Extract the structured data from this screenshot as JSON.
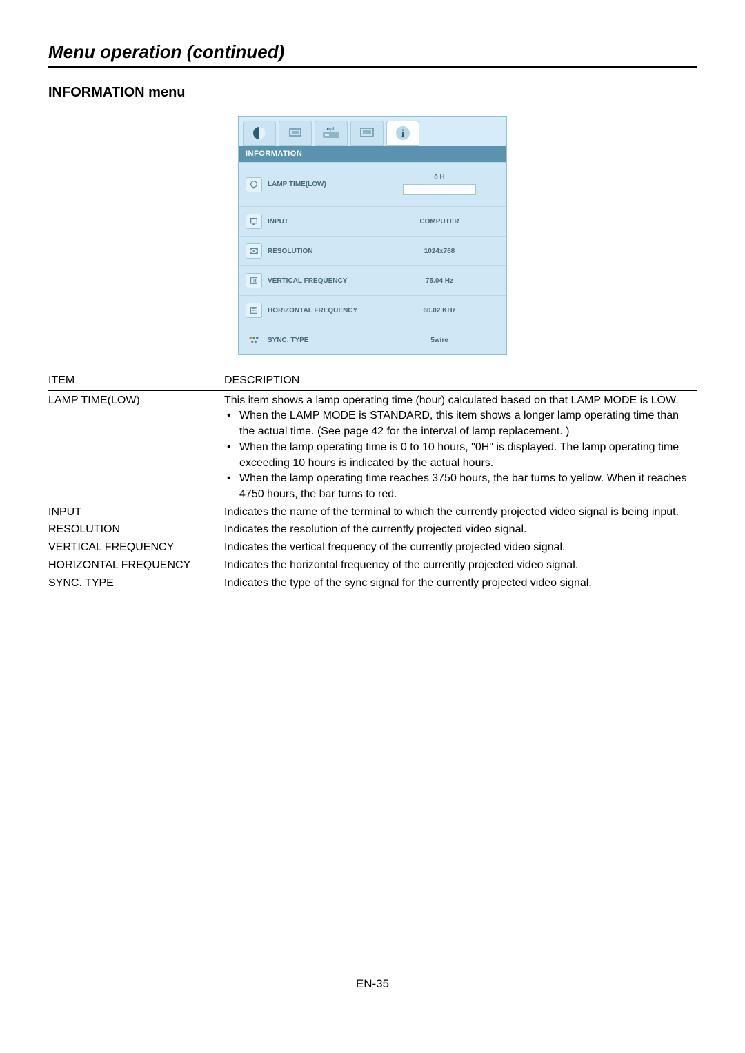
{
  "header": {
    "section_title": "Menu operation (continued)",
    "menu_title": "INFORMATION menu"
  },
  "osd": {
    "tab_opt_label": "opt.",
    "section_label": "INFORMATION",
    "rows": [
      {
        "label": "LAMP TIME(LOW)",
        "value": "0 H"
      },
      {
        "label": "INPUT",
        "value": "COMPUTER"
      },
      {
        "label": "RESOLUTION",
        "value": "1024x768"
      },
      {
        "label": "VERTICAL FREQUENCY",
        "value": "75.04 Hz"
      },
      {
        "label": "HORIZONTAL FREQUENCY",
        "value": "60.02 KHz"
      },
      {
        "label": "SYNC. TYPE",
        "value": "5wire"
      }
    ]
  },
  "table": {
    "head_item": "ITEM",
    "head_desc": "DESCRIPTION",
    "rows": {
      "lamp": {
        "item": "LAMP TIME(LOW)",
        "intro": "This item shows a lamp operating time (hour) calculated based on that LAMP MODE is LOW.",
        "bullets": [
          "When the LAMP MODE is STANDARD, this item shows a longer lamp operating time than the actual time. (See page 42 for the interval of lamp replacement. )",
          "When the lamp operating time is 0 to 10 hours, \"0H\" is displayed. The lamp operating time exceeding 10 hours is indicated by the actual hours.",
          "When the lamp operating time reaches 3750 hours, the bar turns to yellow. When it reaches 4750 hours, the bar turns to red."
        ]
      },
      "input": {
        "item": "INPUT",
        "desc": "Indicates the name of the terminal to which the currently projected video signal is being input."
      },
      "resolution": {
        "item": "RESOLUTION",
        "desc": "Indicates the resolution of the currently projected video signal."
      },
      "vfreq": {
        "item": "VERTICAL FREQUENCY",
        "desc": "Indicates the vertical frequency of the currently projected video signal."
      },
      "hfreq": {
        "item": "HORIZONTAL FREQUENCY",
        "desc": "Indicates the horizontal frequency of the currently projected video signal."
      },
      "sync": {
        "item": "SYNC. TYPE",
        "desc": "Indicates the type of the sync signal for the currently projected video signal."
      }
    }
  },
  "page_number": "EN-35"
}
